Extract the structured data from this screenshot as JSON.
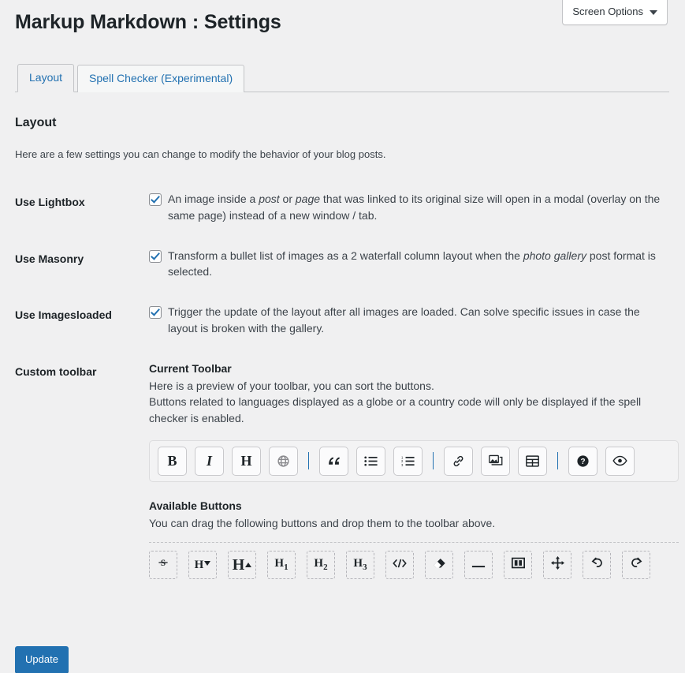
{
  "screen_options": {
    "label": "Screen Options",
    "caret_icon": "chevron-down-icon"
  },
  "page": {
    "title": "Markup Markdown : Settings"
  },
  "tabs": [
    {
      "label": "Layout",
      "active": true
    },
    {
      "label": "Spell Checker (Experimental)",
      "active": false
    }
  ],
  "section": {
    "heading": "Layout",
    "description": "Here are a few settings you can change to modify the behavior of your blog posts."
  },
  "settings_rows": [
    {
      "label": "Use Lightbox",
      "checked": true,
      "description_parts": [
        {
          "text": "An image inside a ",
          "italic": false
        },
        {
          "text": "post",
          "italic": true
        },
        {
          "text": " or ",
          "italic": false
        },
        {
          "text": "page",
          "italic": true
        },
        {
          "text": " that was linked to its original size will open in a modal (overlay on the same page) instead of a new window / tab.",
          "italic": false
        }
      ]
    },
    {
      "label": "Use Masonry",
      "checked": true,
      "description_parts": [
        {
          "text": "Transform a bullet list of images as a 2 waterfall column layout when the ",
          "italic": false
        },
        {
          "text": "photo gallery",
          "italic": true
        },
        {
          "text": " post format is selected.",
          "italic": false
        }
      ]
    },
    {
      "label": "Use Imagesloaded",
      "checked": true,
      "description_parts": [
        {
          "text": "Trigger the update of the layout after all images are loaded. Can solve specific issues in case the layout is broken with the gallery.",
          "italic": false
        }
      ]
    }
  ],
  "custom_toolbar": {
    "label": "Custom toolbar",
    "current_heading": "Current Toolbar",
    "current_desc_line1": "Here is a preview of your toolbar, you can sort the buttons.",
    "current_desc_line2": "Buttons related to languages displayed as a globe or a country code will only be displayed if the spell checker is enabled.",
    "available_heading": "Available Buttons",
    "available_desc": "You can drag the following buttons and drop them to the toolbar above.",
    "current_buttons": [
      {
        "icon": "bold-icon",
        "glyph": "B"
      },
      {
        "icon": "italic-icon",
        "glyph": "I"
      },
      {
        "icon": "heading-icon",
        "glyph": "H"
      },
      {
        "icon": "globe-icon",
        "glyph": ""
      },
      {
        "icon": "separator",
        "glyph": "|"
      },
      {
        "icon": "blockquote-icon",
        "glyph": "“"
      },
      {
        "icon": "unordered-list-icon",
        "glyph": ""
      },
      {
        "icon": "ordered-list-icon",
        "glyph": ""
      },
      {
        "icon": "separator",
        "glyph": "|"
      },
      {
        "icon": "link-icon",
        "glyph": ""
      },
      {
        "icon": "gallery-image-icon",
        "glyph": ""
      },
      {
        "icon": "table-icon",
        "glyph": ""
      },
      {
        "icon": "separator",
        "glyph": "|"
      },
      {
        "icon": "help-icon",
        "glyph": "?"
      },
      {
        "icon": "preview-eye-icon",
        "glyph": ""
      }
    ],
    "available_buttons": [
      {
        "icon": "strikethrough-icon",
        "glyph": "S"
      },
      {
        "icon": "heading-decrease-icon",
        "glyph": "H"
      },
      {
        "icon": "heading-increase-icon",
        "glyph": "H"
      },
      {
        "icon": "heading-1-icon",
        "glyph": "H1"
      },
      {
        "icon": "heading-2-icon",
        "glyph": "H2"
      },
      {
        "icon": "heading-3-icon",
        "glyph": "H3"
      },
      {
        "icon": "code-icon",
        "glyph": "</>"
      },
      {
        "icon": "eraser-icon",
        "glyph": ""
      },
      {
        "icon": "horizontal-rule-icon",
        "glyph": "—"
      },
      {
        "icon": "layout-columns-icon",
        "glyph": ""
      },
      {
        "icon": "move-icon",
        "glyph": ""
      },
      {
        "icon": "undo-icon",
        "glyph": ""
      },
      {
        "icon": "redo-icon",
        "glyph": ""
      }
    ]
  },
  "submit": {
    "label": "Update"
  },
  "colors": {
    "accent": "#2271b1",
    "page_background": "#f0f0f1",
    "text": "#3c434a",
    "heading": "#1d2327",
    "border": "#c3c4c7"
  }
}
